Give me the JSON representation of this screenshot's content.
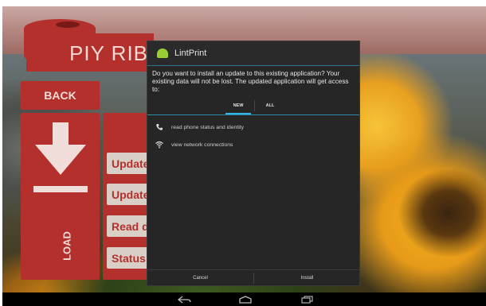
{
  "app": {
    "logo_text": "PIY RIBBO",
    "back_label": "BACK",
    "load_label": "LOAD",
    "status_buttons": [
      "Update",
      "Update",
      "Read da",
      "Status:"
    ],
    "accent": "#b3302c"
  },
  "dialog": {
    "title": "LintPrint",
    "message": "Do you want to install an update to this existing application? Your existing data will not be lost. The updated application will get access to:",
    "tabs": [
      {
        "label": "NEW",
        "selected": true
      },
      {
        "label": "ALL",
        "selected": false
      }
    ],
    "permissions": [
      {
        "icon": "phone-icon",
        "label": "read phone status and identity"
      },
      {
        "icon": "wifi-icon",
        "label": "view network connections"
      }
    ],
    "cancel_label": "Cancel",
    "install_label": "Install",
    "accent": "#33b5e5"
  },
  "navbar": {
    "icons": [
      "back-icon",
      "home-icon",
      "recents-icon"
    ]
  }
}
